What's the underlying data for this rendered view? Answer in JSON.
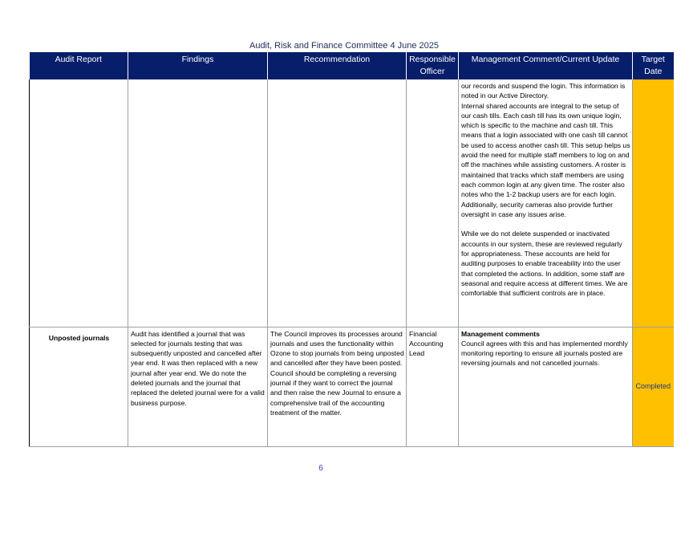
{
  "document": {
    "title": "Audit, Risk and Finance Committee 4 June 2025",
    "page_number": "6"
  },
  "table": {
    "headers": {
      "audit_report": "Audit Report",
      "findings": "Findings",
      "recommendation": "Recommendation",
      "responsible_officer": "Responsible Officer",
      "management_comment": "Management Comment/Current Update",
      "target_date": "Target Date"
    },
    "rows": [
      {
        "audit_report": "",
        "findings": "",
        "recommendation": "",
        "responsible_officer": "",
        "management_comment": "our records and suspend the login. This information is noted in our Active Directory.\nInternal shared accounts are integral to the setup of our cash tills. Each cash till has its own unique login, which is specific to the machine and cash till. This means that a login associated with one cash till cannot be used to access another cash till. This setup helps us avoid the need for multiple staff members to log on and off the machines while assisting customers. A roster is maintained that tracks which staff members are using each common login at any given time. The roster also notes who the 1-2 backup users are for each login. Additionally, security cameras also provide further oversight in case any issues arise.\n\nWhile we do not delete suspended or inactivated accounts in our system, these are reviewed regularly for appropriateness. These accounts are held for auditing purposes to enable traceability into the user that completed the actions. In addition, some staff are seasonal and require access at different times.  We are comfortable that sufficient controls are in place.",
        "target_date": ""
      },
      {
        "audit_report": "Unposted journals",
        "findings": "Audit has identified a journal that was selected for journals testing that was subsequently unposted and cancelled after year end. It was then replaced with a new journal after year end. We do note the deleted journals and the journal that replaced the deleted journal were for a valid business purpose.",
        "recommendation": "The Council improves its processes around journals and uses the functionality within Ozone to stop journals from being unposted and cancelled after they have been posted. Council should be completing a reversing journal if they want to correct the journal and then raise the new Journal to ensure a comprehensive trail of the accounting treatment of the matter.",
        "responsible_officer": "Financial Accounting Lead",
        "management_comment_heading": "Management comments",
        "management_comment": "Council agrees with this and has implemented monthly monitoring reporting to ensure all journals posted are reversing journals and not cancelled journals.",
        "target_date": "Completed"
      }
    ]
  },
  "colors": {
    "header_background": "#071e6b",
    "target_date_fill": "#ffc000"
  }
}
